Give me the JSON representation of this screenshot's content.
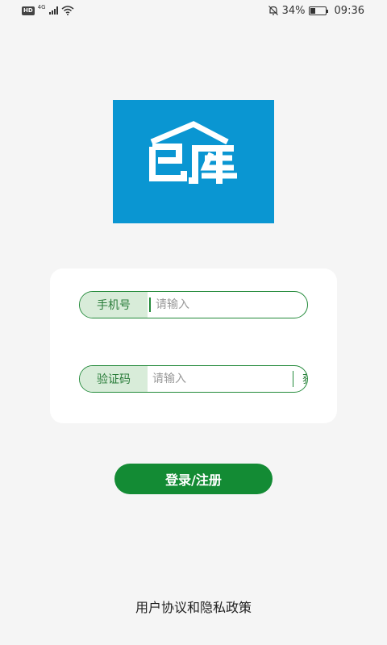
{
  "status_bar": {
    "hd": "HD",
    "network": "4G",
    "battery_text": "34%",
    "battery_level": 0.34,
    "time": "09:36",
    "icons": [
      "signal-icon",
      "wifi-icon",
      "mute-bell-icon",
      "battery-icon"
    ]
  },
  "logo": {
    "text": "巴库",
    "background_color": "#0A96D2",
    "icon": "house-roof-icon"
  },
  "form": {
    "phone": {
      "label": "手机号",
      "placeholder": "请输入",
      "value": ""
    },
    "code": {
      "label": "验证码",
      "placeholder": "请输入",
      "value": "",
      "button_label": "获取验证码"
    }
  },
  "login_button": {
    "label": "登录/注册",
    "color": "#138B34"
  },
  "agreement": {
    "label": "用户协议和隐私政策"
  },
  "colors": {
    "accent": "#238A3A",
    "label_bg": "#D8ECD9",
    "page_bg": "#F5F5F5"
  }
}
